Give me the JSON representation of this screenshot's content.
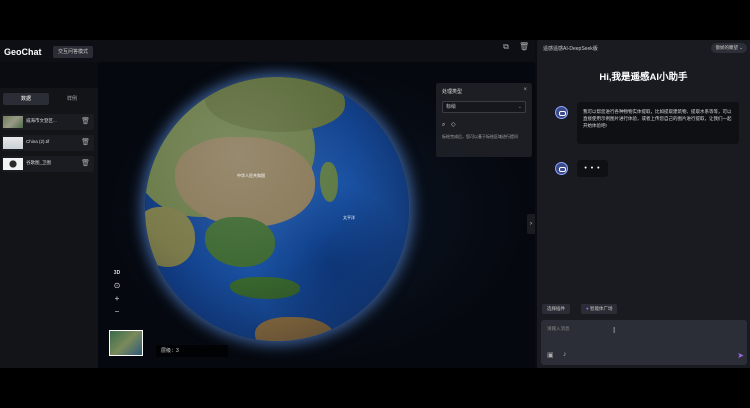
{
  "header": {
    "logo": "GeoChat",
    "mode_button": "交互问答模式"
  },
  "left_panel": {
    "tabs": [
      "数据",
      "样例"
    ],
    "layers": [
      {
        "name": "威海市文登区..."
      },
      {
        "name": "China (2).tif"
      },
      {
        "name": "谷歌图_卫图"
      }
    ]
  },
  "map": {
    "labels": [
      "中华人民共和国",
      "太平洋"
    ],
    "zoom": {
      "mode_3d": "3D",
      "compass": "⊙",
      "zoom_in": "+",
      "zoom_out": "−"
    },
    "scale_text": "层级：3"
  },
  "process_panel": {
    "title": "处理类型",
    "close": "×",
    "select_value": "标绘",
    "tip": "标绘完成后，您可以基于标绘区域进行提问"
  },
  "chat": {
    "model_name": "遥感遥感AI-DeepSeek版",
    "user_name": "傲娇的瞭望",
    "title": "Hi,我是遥感AI小助手",
    "bot_message": "我可以帮您进行各种物物实体提取，比如提取建筑物、提取水系等等，可以直接使用示例图片进行体验，或者上传您自己的图片进行提取，让我们一起开始体验吧!",
    "typing_indicator": "• • •",
    "quick_buttons": [
      "选择插件",
      "智能体广场"
    ],
    "input_placeholder": "请输入消息",
    "colors": {
      "accent": "#a267e6",
      "panel": "#191b21"
    }
  }
}
